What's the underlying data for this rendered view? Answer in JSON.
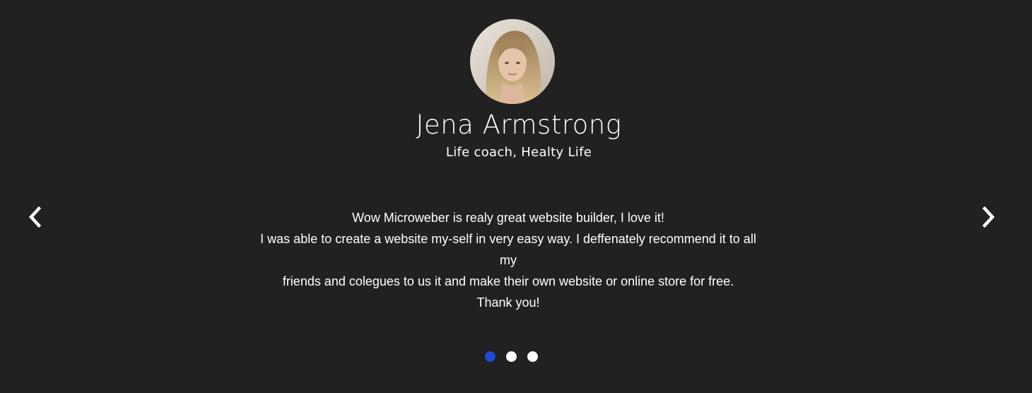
{
  "testimonial": {
    "name": "Jena Armstrong",
    "role": "Life coach, Healty Life",
    "quote_lines": [
      "Wow Microweber is realy great website builder, I love it!",
      "I was able to create a website my-self in very easy way. I deffenately recommend it to all my",
      "friends and colegues to us it and make their own website or online store for free.",
      "Thank you!"
    ]
  },
  "navigation": {
    "prev_icon": "chevron-left-icon",
    "next_icon": "chevron-right-icon"
  },
  "pagination": {
    "slide_count": 3,
    "active_index": 0
  },
  "colors": {
    "background": "#212121",
    "text": "#ffffff",
    "active_dot": "#2149d6",
    "inactive_dot": "#ffffff"
  }
}
